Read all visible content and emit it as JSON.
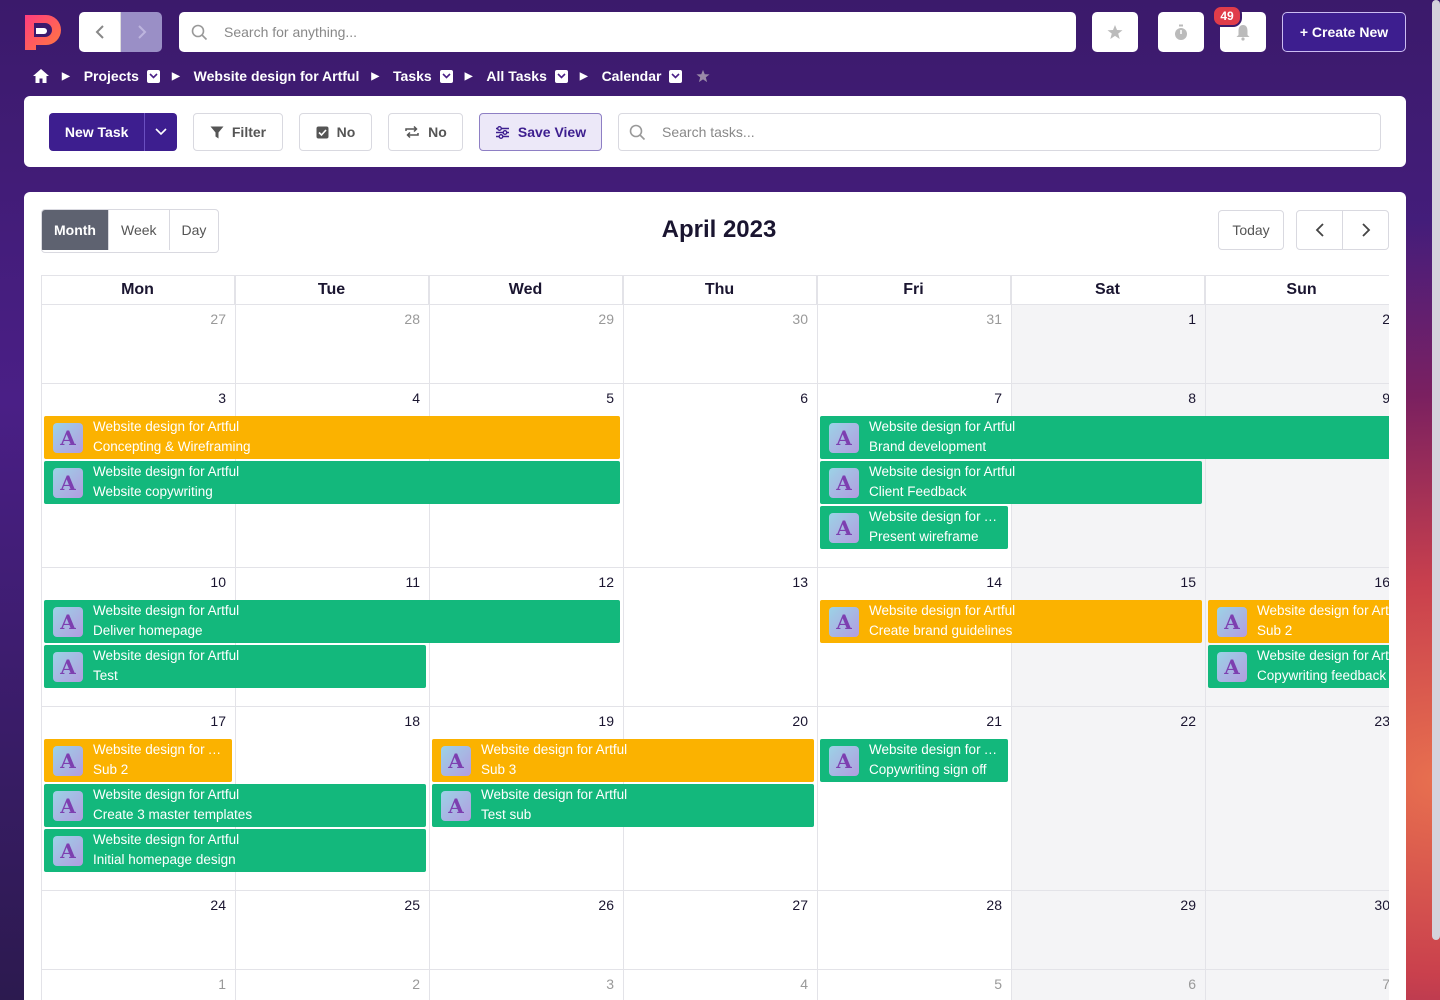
{
  "topbar": {
    "search_placeholder": "Search for anything...",
    "notification_count": "49",
    "create_label": "+ Create New"
  },
  "breadcrumb": {
    "items": [
      "Projects",
      "Website design for Artful",
      "Tasks",
      "All Tasks",
      "Calendar"
    ]
  },
  "toolbar": {
    "new_task_label": "New Task",
    "filter_label": "Filter",
    "check_label": "No",
    "repeat_label": "No",
    "save_view_label": "Save View",
    "search_placeholder": "Search tasks..."
  },
  "calendar": {
    "views": [
      "Month",
      "Week",
      "Day"
    ],
    "active_view": "Month",
    "title": "April 2023",
    "today_label": "Today",
    "weekdays": [
      "Mon",
      "Tue",
      "Wed",
      "Thu",
      "Fri",
      "Sat",
      "Sun"
    ],
    "weeks": [
      [
        {
          "d": "27",
          "cur": false
        },
        {
          "d": "28",
          "cur": false
        },
        {
          "d": "29",
          "cur": false
        },
        {
          "d": "30",
          "cur": false
        },
        {
          "d": "31",
          "cur": false
        },
        {
          "d": "1",
          "cur": true
        },
        {
          "d": "2",
          "cur": true
        }
      ],
      [
        {
          "d": "3",
          "cur": true
        },
        {
          "d": "4",
          "cur": true
        },
        {
          "d": "5",
          "cur": true
        },
        {
          "d": "6",
          "cur": true
        },
        {
          "d": "7",
          "cur": true
        },
        {
          "d": "8",
          "cur": true
        },
        {
          "d": "9",
          "cur": true
        }
      ],
      [
        {
          "d": "10",
          "cur": true
        },
        {
          "d": "11",
          "cur": true
        },
        {
          "d": "12",
          "cur": true
        },
        {
          "d": "13",
          "cur": true
        },
        {
          "d": "14",
          "cur": true
        },
        {
          "d": "15",
          "cur": true
        },
        {
          "d": "16",
          "cur": true
        }
      ],
      [
        {
          "d": "17",
          "cur": true
        },
        {
          "d": "18",
          "cur": true
        },
        {
          "d": "19",
          "cur": true
        },
        {
          "d": "20",
          "cur": true
        },
        {
          "d": "21",
          "cur": true
        },
        {
          "d": "22",
          "cur": true
        },
        {
          "d": "23",
          "cur": true
        }
      ],
      [
        {
          "d": "24",
          "cur": true
        },
        {
          "d": "25",
          "cur": true
        },
        {
          "d": "26",
          "cur": true
        },
        {
          "d": "27",
          "cur": true
        },
        {
          "d": "28",
          "cur": true
        },
        {
          "d": "29",
          "cur": true
        },
        {
          "d": "30",
          "cur": true
        }
      ],
      [
        {
          "d": "1",
          "cur": false
        },
        {
          "d": "2",
          "cur": false
        },
        {
          "d": "3",
          "cur": false
        },
        {
          "d": "4",
          "cur": false
        },
        {
          "d": "5",
          "cur": false
        },
        {
          "d": "6",
          "cur": false
        },
        {
          "d": "7",
          "cur": false
        }
      ]
    ],
    "events": [
      {
        "week": 1,
        "lane": 0,
        "start": 0,
        "span": 3,
        "color": "yellow",
        "project": "Website design for Artful",
        "task": "Concepting & Wireframing"
      },
      {
        "week": 1,
        "lane": 1,
        "start": 0,
        "span": 3,
        "color": "green",
        "project": "Website design for Artful",
        "task": "Website copywriting"
      },
      {
        "week": 1,
        "lane": 0,
        "start": 4,
        "span": 3,
        "color": "green",
        "project": "Website design for Artful",
        "task": "Brand development"
      },
      {
        "week": 1,
        "lane": 1,
        "start": 4,
        "span": 2,
        "color": "green",
        "project": "Website design for Artful",
        "task": "Client Feedback"
      },
      {
        "week": 1,
        "lane": 2,
        "start": 4,
        "span": 1,
        "color": "green",
        "project": "Website design for Artful",
        "task": "Present wireframe"
      },
      {
        "week": 2,
        "lane": 0,
        "start": 0,
        "span": 3,
        "color": "green",
        "project": "Website design for Artful",
        "task": "Deliver homepage"
      },
      {
        "week": 2,
        "lane": 1,
        "start": 0,
        "span": 2,
        "color": "green",
        "project": "Website design for Artful",
        "task": "Test"
      },
      {
        "week": 2,
        "lane": 0,
        "start": 4,
        "span": 2,
        "color": "yellow",
        "project": "Website design for Artful",
        "task": "Create brand guidelines"
      },
      {
        "week": 2,
        "lane": 0,
        "start": 6,
        "span": 1,
        "color": "yellow",
        "project": "Website design for Artful",
        "task": "Sub 2"
      },
      {
        "week": 2,
        "lane": 1,
        "start": 6,
        "span": 1,
        "color": "green",
        "project": "Website design for Artful",
        "task": "Copywriting feedback"
      },
      {
        "week": 3,
        "lane": 0,
        "start": 0,
        "span": 1,
        "color": "yellow",
        "project": "Website design for Artful",
        "task": "Sub 2"
      },
      {
        "week": 3,
        "lane": 1,
        "start": 0,
        "span": 2,
        "color": "green",
        "project": "Website design for Artful",
        "task": "Create 3 master templates"
      },
      {
        "week": 3,
        "lane": 2,
        "start": 0,
        "span": 2,
        "color": "green",
        "project": "Website design for Artful",
        "task": "Initial homepage design"
      },
      {
        "week": 3,
        "lane": 0,
        "start": 2,
        "span": 2,
        "color": "yellow",
        "project": "Website design for Artful",
        "task": "Sub 3"
      },
      {
        "week": 3,
        "lane": 1,
        "start": 2,
        "span": 2,
        "color": "green",
        "project": "Website design for Artful",
        "task": "Test sub"
      },
      {
        "week": 3,
        "lane": 0,
        "start": 4,
        "span": 1,
        "color": "green",
        "project": "Website design for Artful",
        "task": "Copywriting sign off"
      }
    ]
  },
  "colors": {
    "green": "#13b87c",
    "yellow": "#fbb200",
    "primary": "#3d1e8f"
  }
}
